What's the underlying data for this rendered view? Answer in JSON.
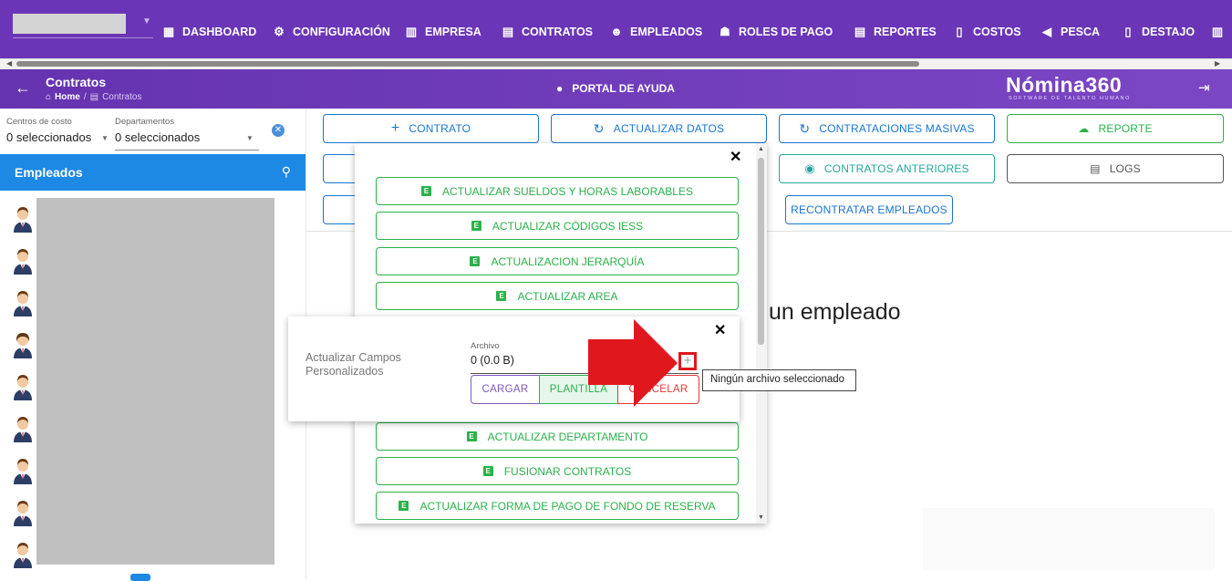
{
  "topnav": {
    "items": [
      {
        "label": "DASHBOARD",
        "icon": "dashboard-icon"
      },
      {
        "label": "CONFIGURACIÓN",
        "icon": "gear-icon"
      },
      {
        "label": "EMPRESA",
        "icon": "building-icon"
      },
      {
        "label": "CONTRATOS",
        "icon": "clipboard-icon"
      },
      {
        "label": "EMPLEADOS",
        "icon": "face-icon"
      },
      {
        "label": "ROLES DE PAGO",
        "icon": "users-icon"
      },
      {
        "label": "REPORTES",
        "icon": "clipboard-icon"
      },
      {
        "label": "COSTOS",
        "icon": "invoice-icon"
      },
      {
        "label": "PESCA",
        "icon": "fish-icon"
      },
      {
        "label": "DESTAJO",
        "icon": "document-icon"
      }
    ]
  },
  "subbar": {
    "title": "Contratos",
    "breadcrumb_home": "Home",
    "breadcrumb_sep": "/",
    "breadcrumb_current": "Contratos",
    "help_label": "PORTAL DE AYUDA",
    "logo_text": "Nómina360",
    "logo_tagline": "SOFTWARE DE TALENTO HUMANO"
  },
  "filters": {
    "cost_centers_label": "Centros de costo",
    "cost_centers_value": "0 seleccionados",
    "departments_label": "Departamentos",
    "departments_value": "0 seleccionados"
  },
  "employees": {
    "header": "Empleados",
    "avatar_count": 9
  },
  "actions": {
    "contrato": "CONTRATO",
    "actualizar_datos": "ACTUALIZAR DATOS",
    "contrataciones_masivas": "CONTRATACIONES MASIVAS",
    "reporte": "REPORTE",
    "contratos_anteriores": "CONTRATOS ANTERIORES",
    "logs": "LOGS",
    "recontratar": "RECONTRATAR EMPLEADOS"
  },
  "main": {
    "empty_message": "un empleado"
  },
  "dropdown": {
    "items": [
      "ACTUALIZAR SUELDOS Y HORAS LABORABLES",
      "ACTUALIZAR CÓDIGOS IESS",
      "ACTUALIZACION JERARQUÍA",
      "ACTUALIZAR AREA",
      "ACTUALIZAR DEPARTAMENTO",
      "FUSIONAR CONTRATOS",
      "ACTUALIZAR FORMA DE PAGO DE FONDO DE RESERVA"
    ]
  },
  "custom_fields_dialog": {
    "title": "Actualizar Campos Personalizados",
    "file_label": "Archivo",
    "file_value": "0 (0.0 B)",
    "cargar": "CARGAR",
    "plantilla": "PLANTILLA",
    "cancelar": "CANCELAR",
    "tooltip": "Ningún archivo seleccionado"
  },
  "colors": {
    "nav_purple": "#6a35b6",
    "primary_blue": "#1976d2",
    "excel_green": "#2bb14a",
    "teal": "#26a69a",
    "danger_red": "#e0181e"
  }
}
